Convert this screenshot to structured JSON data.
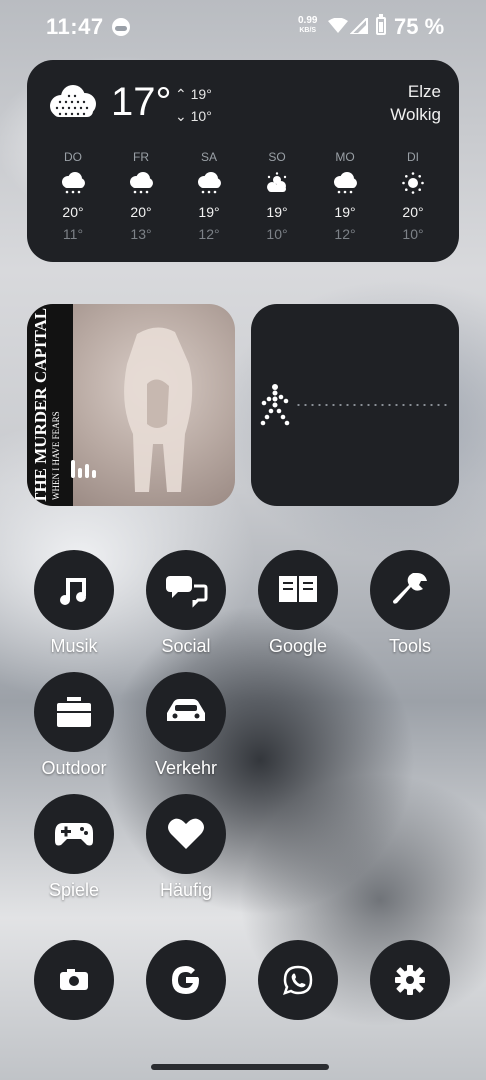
{
  "status": {
    "time": "11:47",
    "net_speed": "0.99",
    "net_unit": "KB/S",
    "battery": "75 %"
  },
  "weather": {
    "temp": "17°",
    "high": "19°",
    "low": "10°",
    "city": "Elze",
    "condition": "Wolkig",
    "days": [
      {
        "name": "DO",
        "icon": "snow-cloud-icon",
        "hi": "20°",
        "lo": "11°"
      },
      {
        "name": "FR",
        "icon": "snow-cloud-icon",
        "hi": "20°",
        "lo": "13°"
      },
      {
        "name": "SA",
        "icon": "snow-cloud-icon",
        "hi": "19°",
        "lo": "12°"
      },
      {
        "name": "SO",
        "icon": "partly-sunny-icon",
        "hi": "19°",
        "lo": "10°"
      },
      {
        "name": "MO",
        "icon": "snow-cloud-icon",
        "hi": "19°",
        "lo": "12°"
      },
      {
        "name": "DI",
        "icon": "sun-icon",
        "hi": "20°",
        "lo": "10°"
      }
    ]
  },
  "album": {
    "artist": "THE MURDER CAPITAL",
    "title": "WHEN I HAVE FEARS"
  },
  "apps": [
    {
      "label": "Musik",
      "icon": "music-note-icon"
    },
    {
      "label": "Social",
      "icon": "chat-bubbles-icon"
    },
    {
      "label": "Google",
      "icon": "book-icon"
    },
    {
      "label": "Tools",
      "icon": "wrench-icon"
    },
    {
      "label": "Outdoor",
      "icon": "briefcase-icon"
    },
    {
      "label": "Verkehr",
      "icon": "car-icon"
    },
    {
      "label": "Spiele",
      "icon": "gamepad-icon"
    },
    {
      "label": "Häufig",
      "icon": "heart-icon"
    }
  ],
  "dock": [
    {
      "icon": "camera-icon"
    },
    {
      "icon": "google-icon"
    },
    {
      "icon": "whatsapp-icon"
    },
    {
      "icon": "settings-gear-icon"
    }
  ]
}
